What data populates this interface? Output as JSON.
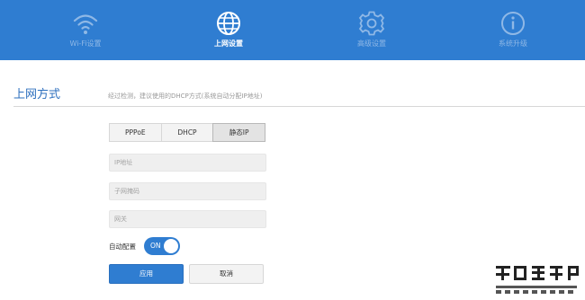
{
  "nav": {
    "items": [
      {
        "label": "Wi-Fi设置",
        "icon": "wifi-icon"
      },
      {
        "label": "上网设置",
        "icon": "globe-icon",
        "active": true
      },
      {
        "label": "高级设置",
        "icon": "gear-icon"
      },
      {
        "label": "系统升级",
        "icon": "info-icon"
      }
    ]
  },
  "section": {
    "title": "上网方式",
    "hint": "经过检测，建议使用的DHCP方式(系统自动分配IP地址)"
  },
  "connection_types": {
    "options": [
      "PPPoE",
      "DHCP",
      "静态IP"
    ],
    "selected": "静态IP"
  },
  "form": {
    "ip_placeholder": "IP地址",
    "mask_placeholder": "子网掩码",
    "gateway_placeholder": "网关",
    "auto_config_label": "自动配置",
    "auto_config_state": "ON"
  },
  "buttons": {
    "apply": "应用",
    "cancel": "取消"
  },
  "colors": {
    "brand": "#2f7dd1",
    "title": "#2d6fbe",
    "nav_inactive": "#8fb8e6"
  },
  "watermark": {
    "icon": "router-site-logo"
  }
}
